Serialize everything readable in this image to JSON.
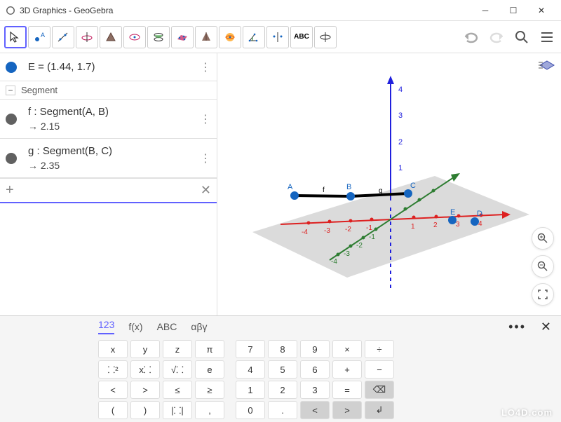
{
  "window": {
    "title": "3D Graphics - GeoGebra"
  },
  "toolbar": {
    "abc": "ABC"
  },
  "algebra": {
    "point_e": "E = (1.44, 1.7)",
    "section_segment": "Segment",
    "f_def": "f : Segment(A, B)",
    "f_val": "→  2.15",
    "g_def": "g : Segment(B, C)",
    "g_val": "→  2.35"
  },
  "keyboard": {
    "tabs": {
      "t1": "123",
      "t2": "f(x)",
      "t3": "ABC",
      "t4": "αβγ"
    },
    "r1c1": "x",
    "r1c2": "y",
    "r1c3": "z",
    "r1c4": "π",
    "r1c5": "7",
    "r1c6": "8",
    "r1c7": "9",
    "r1c8": "×",
    "r1c9": "÷",
    "r2c1": "⸬²",
    "r2c2": "x⸬",
    "r2c3": "√⸬",
    "r2c4": "e",
    "r2c5": "4",
    "r2c6": "5",
    "r2c7": "6",
    "r2c8": "+",
    "r2c9": "−",
    "r3c1": "<",
    "r3c2": ">",
    "r3c3": "≤",
    "r3c4": "≥",
    "r3c5": "1",
    "r3c6": "2",
    "r3c7": "3",
    "r3c8": "=",
    "r3c9": "⌫",
    "r4c1": "(",
    "r4c2": ")",
    "r4c3": "|⸬|",
    "r4c4": ",",
    "r4c5": "0",
    "r4c6": ".",
    "r4c7": "<",
    "r4c8": ">",
    "r4c9": "↲"
  },
  "graphics3d": {
    "point_labels": {
      "A": "A",
      "B": "B",
      "C": "C",
      "D": "D",
      "E": "E"
    },
    "segment_labels": {
      "f": "f",
      "g": "g"
    },
    "axis_ticks": [
      "-4",
      "-3",
      "-2",
      "-1",
      "1",
      "2",
      "3",
      "4"
    ]
  },
  "watermark": "LO4D.com"
}
